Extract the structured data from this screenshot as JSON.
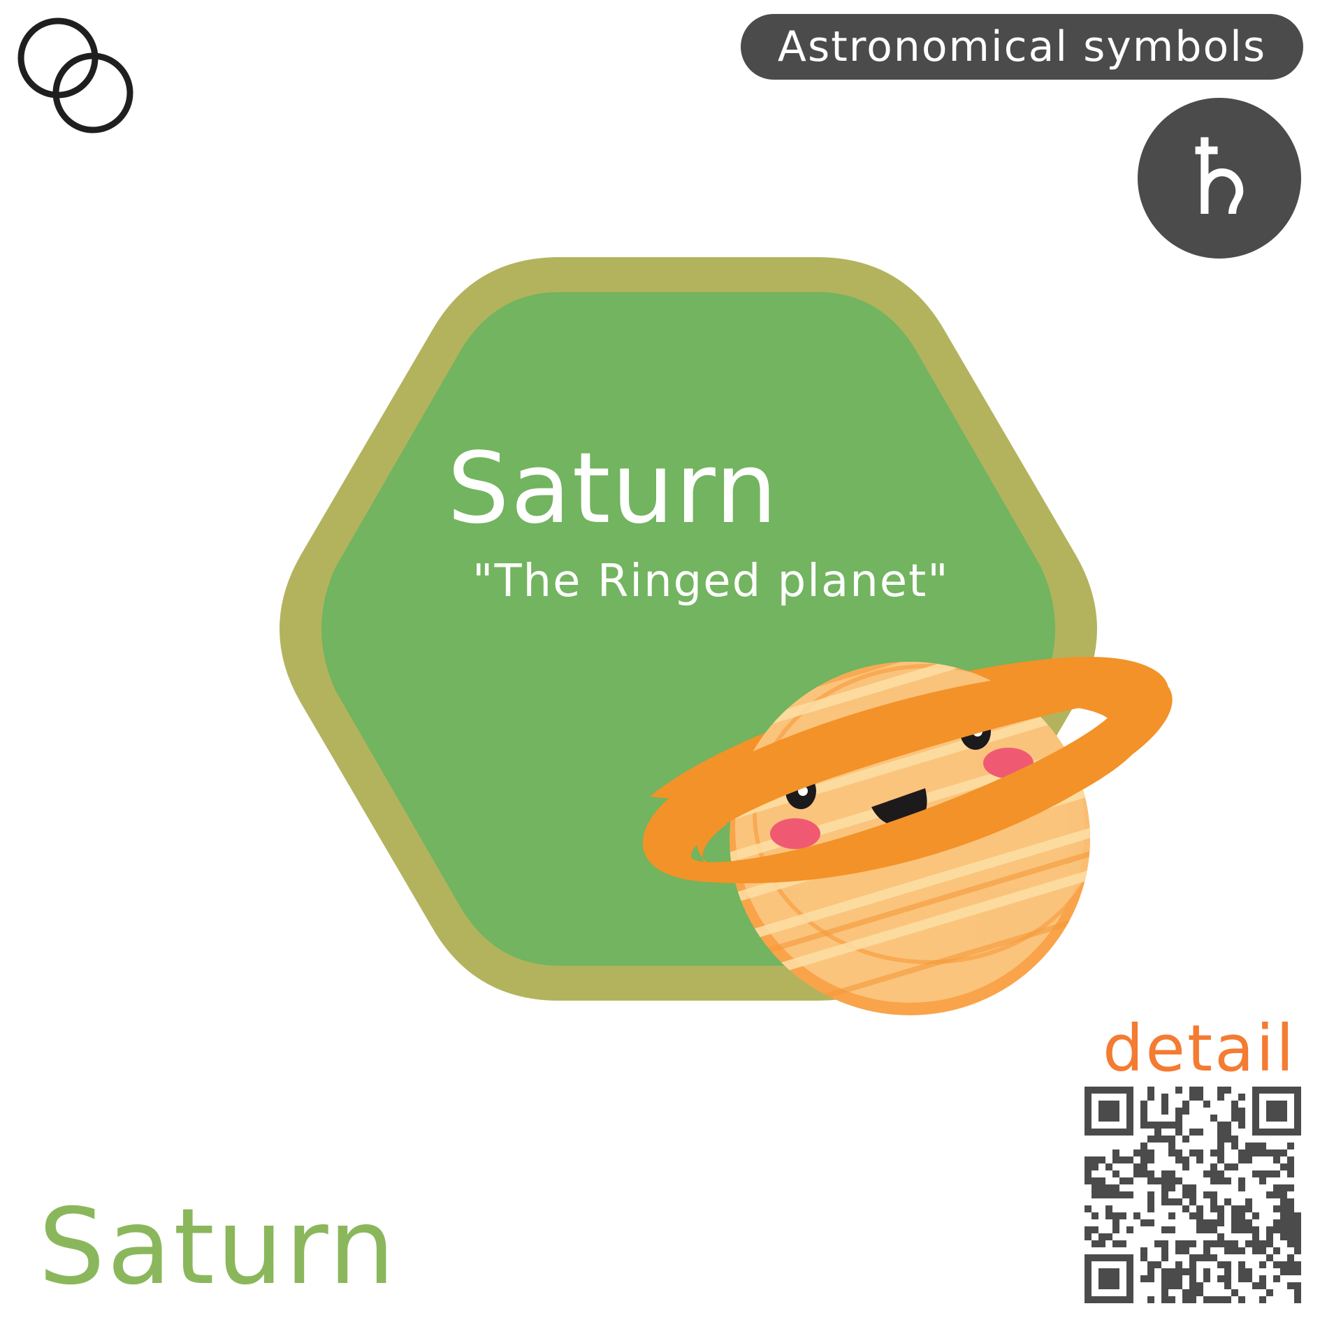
{
  "header": {
    "badge_label": "Astronomical symbols",
    "symbol_glyph": "♄"
  },
  "card": {
    "title": "Saturn",
    "subtitle": "\"The Ringed planet\""
  },
  "detail": {
    "label": "detail"
  },
  "footer": {
    "name": "Saturn"
  },
  "icons": {
    "logo": "interlocking-circles-icon",
    "planet": "saturn-planet-icon",
    "qr": "qr-code-icon"
  },
  "colors": {
    "badge_bg": "#4b4b4b",
    "hex_border": "#b3b35e",
    "hex_fill": "#72b45f",
    "planet_body": "#fbc47c",
    "planet_ring": "#f39228",
    "detail_text": "#f47b32",
    "footer_text": "#8ab75c",
    "qr": "#4b4b4b"
  }
}
